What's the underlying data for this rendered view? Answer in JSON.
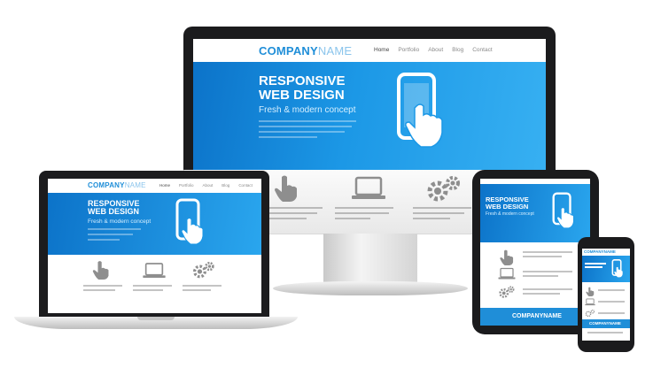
{
  "desktop": {
    "brand_bold": "COMPANY",
    "brand_thin": "NAME",
    "nav": [
      "Home",
      "Portfolio",
      "About",
      "Blog",
      "Contact"
    ],
    "hero_title_1": "RESPONSIVE",
    "hero_title_2": "WEB DESIGN",
    "hero_subtitle": "Fresh & modern concept"
  },
  "laptop": {
    "brand_bold": "COMPANY",
    "brand_thin": "NAME",
    "nav": [
      "Home",
      "Portfolio",
      "About",
      "Blog",
      "Contact"
    ],
    "hero_title_1": "RESPONSIVE",
    "hero_title_2": "WEB DESIGN",
    "hero_subtitle": "Fresh & modern concept"
  },
  "tablet": {
    "hero_title_1": "RESPONSIVE",
    "hero_title_2": "WEB DESIGN",
    "hero_subtitle": "Fresh & modern concept",
    "footer_brand": "COMPANYNAME"
  },
  "phone": {
    "brand": "COMPANYNAME",
    "footer_brand": "COMPANYNAME"
  },
  "colors": {
    "brand_blue": "#1f8ed8",
    "hero_blue": "#1c98e6",
    "device_black": "#1b1b1d"
  },
  "icons": [
    "touch-hand-icon",
    "laptop-icon",
    "gears-icon",
    "smartphone-touch-icon"
  ]
}
